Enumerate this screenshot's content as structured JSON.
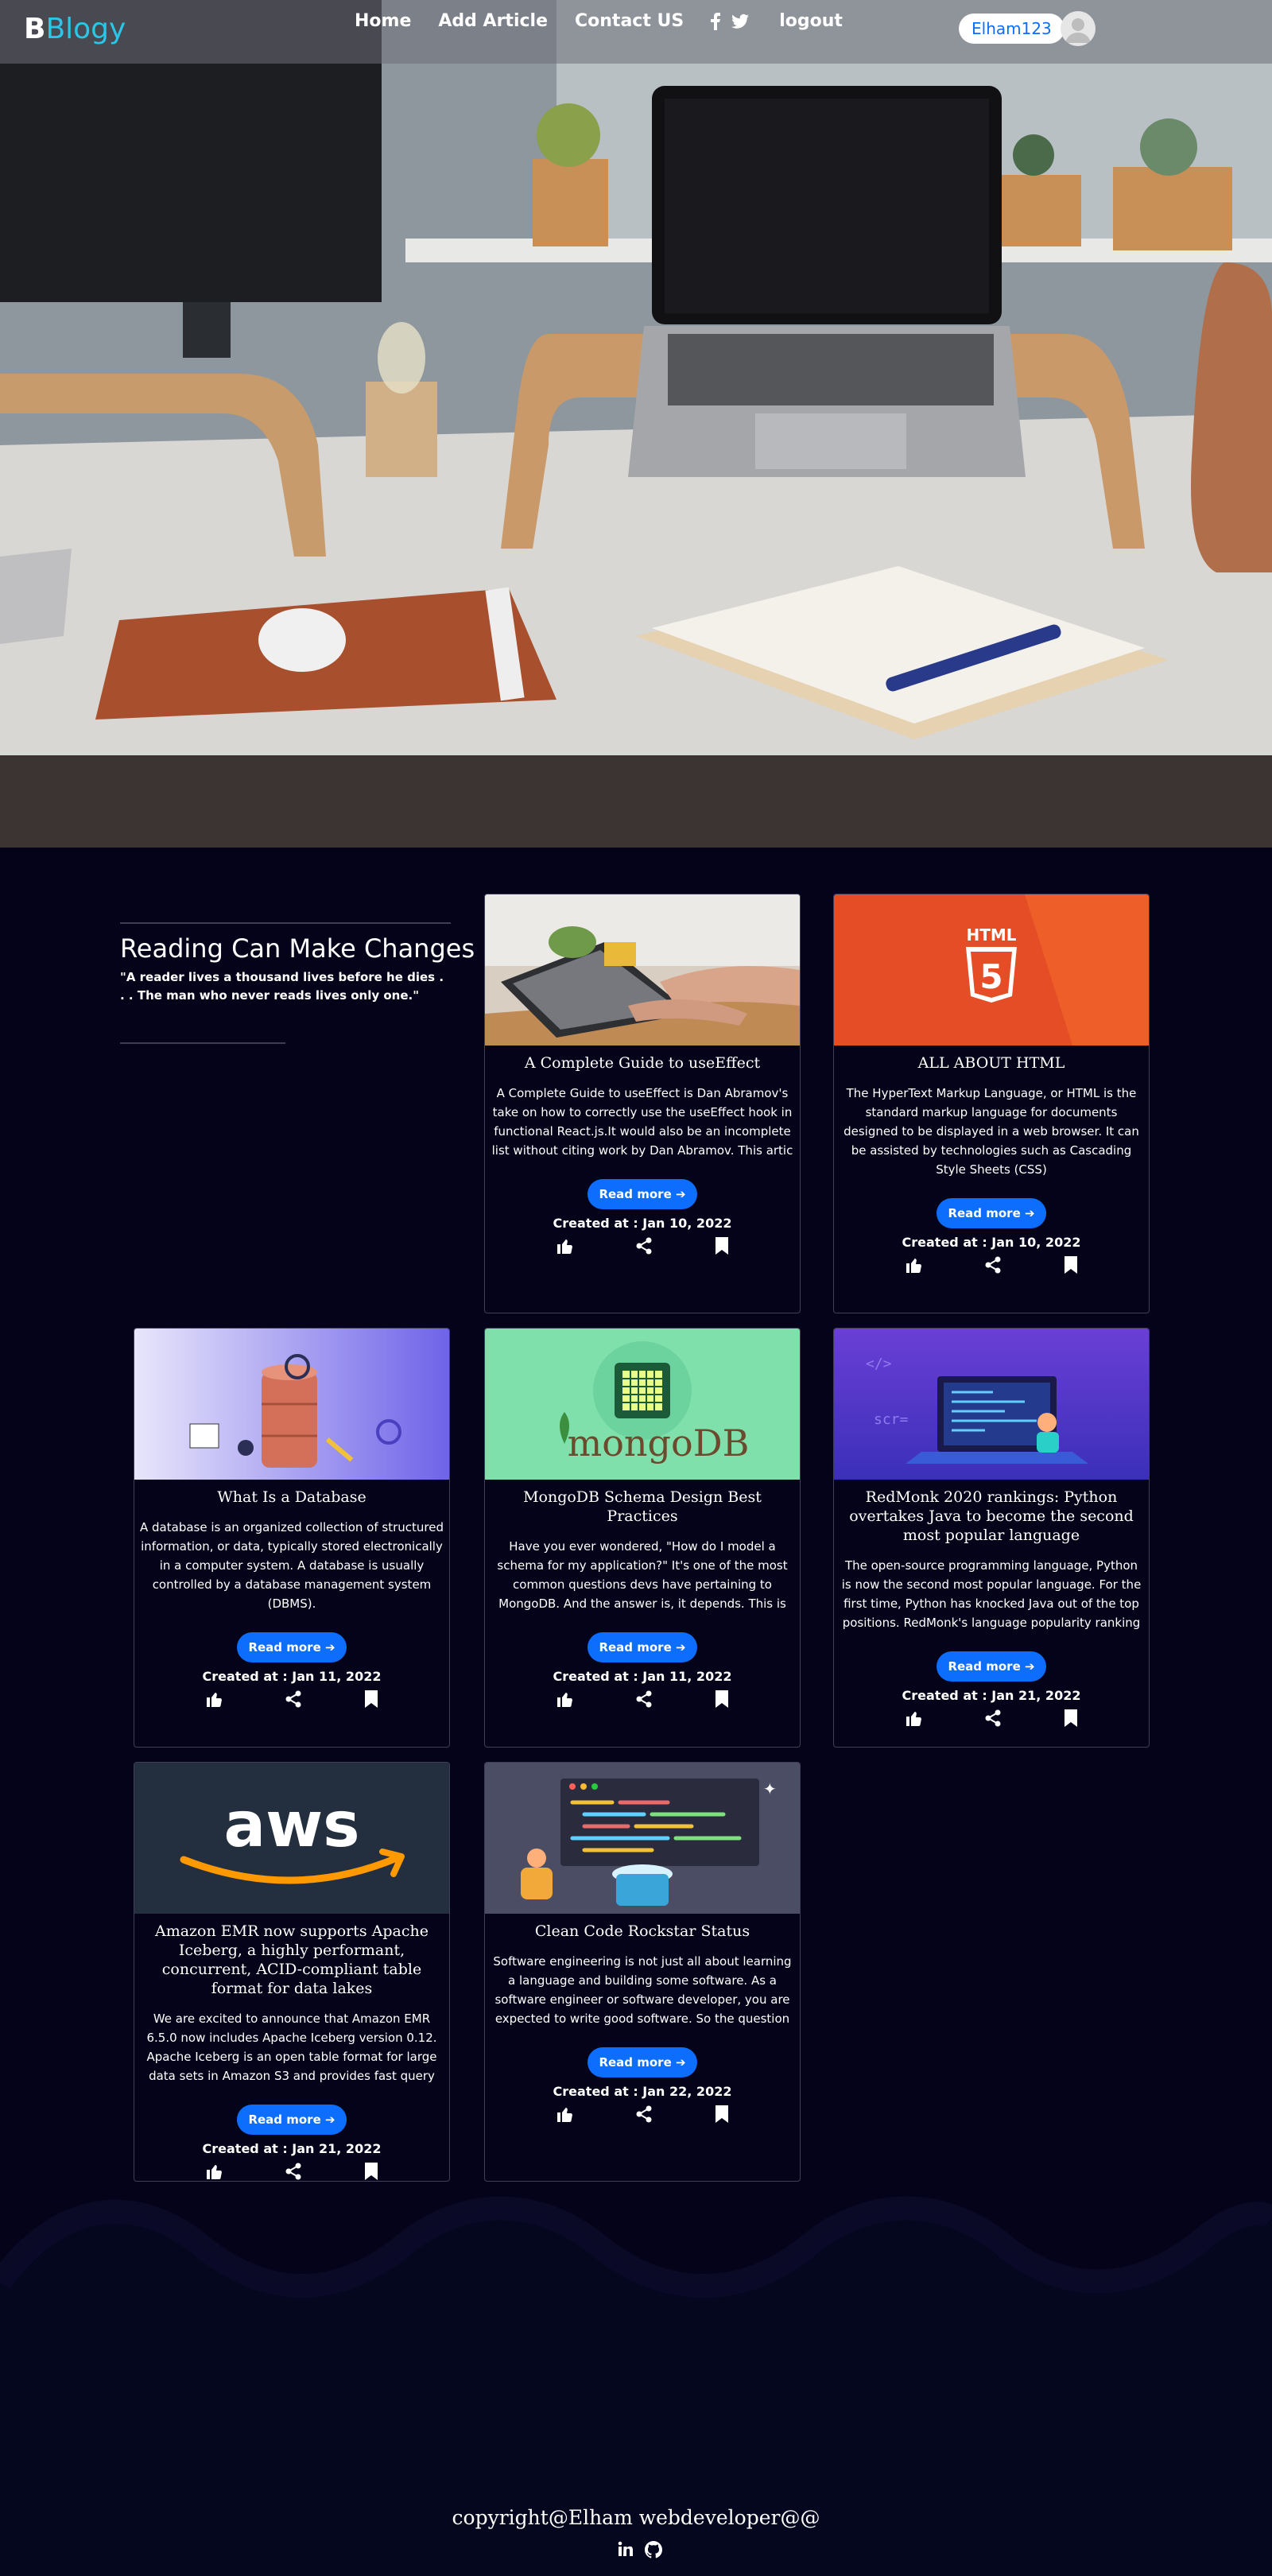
{
  "brand": {
    "b": "B",
    "name": "Blogy"
  },
  "nav": {
    "home": "Home",
    "add_article": "Add Article",
    "contact": "Contact US",
    "logout": "logout",
    "user": "Elham123"
  },
  "intro": {
    "title": "Reading Can Make Changes",
    "quote": "\"A reader lives a thousand lives before he dies . . . The man who never reads lives only one.\""
  },
  "articles": [
    {
      "title": "A Complete Guide to useEffect",
      "text": "A Complete Guide to useEffect is Dan Abramov's take on how to correctly use the useEffect hook in functional React.js.It would also be an incomplete list without citing work by Dan Abramov. This artic",
      "read_more": "Read more",
      "created": "Created at : Jan 10, 2022"
    },
    {
      "title": "ALL ABOUT HTML",
      "text": "The HyperText Markup Language, or HTML is the standard markup language for documents designed to be displayed in a web browser. It can be assisted by technologies such as Cascading Style Sheets (CSS)",
      "read_more": "Read more",
      "created": "Created at : Jan 10, 2022"
    },
    {
      "title": "What Is a Database",
      "text": "A database is an organized collection of structured information, or data, typically stored electronically in a computer system. A database is usually controlled by a database management system (DBMS).",
      "read_more": "Read more",
      "created": "Created at : Jan 11, 2022"
    },
    {
      "title": "MongoDB Schema Design Best Practices",
      "text": "Have you ever wondered, \"How do I model a schema for my application?\" It's one of the most common questions devs have pertaining to MongoDB. And the answer is, it depends. This is because document dat",
      "read_more": "Read more",
      "created": "Created at : Jan 11, 2022"
    },
    {
      "title": "RedMonk 2020 rankings: Python overtakes Java to become the second most popular language",
      "text": "The open-source programming language, Python is now the second most popular language. For the first time, Python has knocked Java out of the top positions. RedMonk's language popularity ranking has pl",
      "read_more": "Read more",
      "created": "Created at : Jan 21, 2022"
    },
    {
      "title": "Amazon EMR now supports Apache Iceberg, a highly performant, concurrent, ACID-compliant table format for data lakes",
      "text": "We are excited to announce that Amazon EMR 6.5.0 now includes Apache Iceberg version 0.12. Apache Iceberg is an open table format for large data sets in Amazon S3 and provides fast query performance o",
      "read_more": "Read more",
      "created": "Created at : Jan 21, 2022"
    },
    {
      "title": "Clean Code Rockstar Status",
      "text": "Software engineering is not just all about learning a language and building some software. As a software engineer or software developer, you are expected to write good software. So the question is wha",
      "read_more": "Read more",
      "created": "Created at : Jan 22, 2022"
    }
  ],
  "images": {
    "html": "HTML",
    "html_num": "5",
    "mongo": "mongoDB",
    "aws": "aws"
  },
  "footer": {
    "copyright": "copyright@Elham webdeveloper@@"
  },
  "icons": {
    "nav": [
      "facebook-icon",
      "twitter-icon"
    ],
    "card_actions": [
      "thumbs-up-icon",
      "share-icon",
      "bookmark-icon"
    ],
    "footer": [
      "linkedin-icon",
      "github-icon"
    ]
  },
  "colors": {
    "accent": "#0d6efd",
    "brand_blue": "#29c6e8",
    "background": "#05031a"
  }
}
